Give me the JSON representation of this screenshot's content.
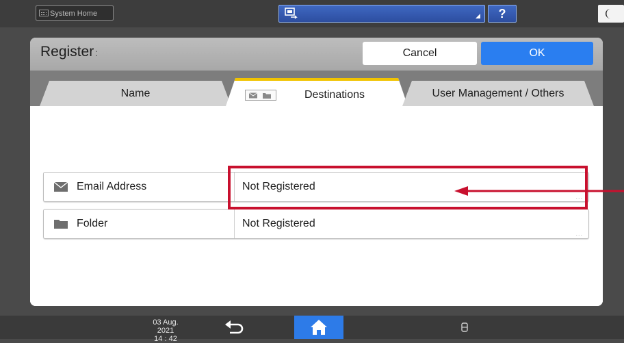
{
  "topbar": {
    "system_home_label": "System Home",
    "app_selector_icon": "screen-switch-icon",
    "help_label": "?",
    "night_icon": "moon-icon"
  },
  "dialog": {
    "title": "Register",
    "title_suffix": ":",
    "cancel_label": "Cancel",
    "ok_label": "OK"
  },
  "tabs": [
    {
      "label": "Name",
      "active": false
    },
    {
      "label": "Destinations",
      "active": true,
      "icons": [
        "envelope-icon",
        "folder-icon"
      ]
    },
    {
      "label": "User Management / Others",
      "active": false
    }
  ],
  "rows": [
    {
      "label": "Email Address",
      "value": "Not Registered",
      "icon": "envelope-icon",
      "more": "..."
    },
    {
      "label": "Folder",
      "value": "Not Registered",
      "icon": "folder-icon",
      "more": "..."
    }
  ],
  "bottombar": {
    "date": "03 Aug. 2021",
    "time": "14 : 42",
    "back_icon": "back-arrow-icon",
    "home_icon": "home-icon",
    "storage_icon": "storage-icon"
  },
  "colors": {
    "accent_blue": "#2a7ef0",
    "active_tab_border": "#f1c300",
    "annotation_red": "#c8102e"
  }
}
